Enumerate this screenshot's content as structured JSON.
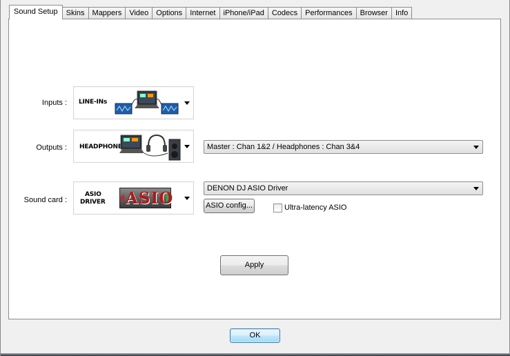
{
  "tabs": [
    {
      "label": "Sound Setup",
      "active": true
    },
    {
      "label": "Skins"
    },
    {
      "label": "Mappers"
    },
    {
      "label": "Video"
    },
    {
      "label": "Options"
    },
    {
      "label": "Internet"
    },
    {
      "label": "iPhone/iPad"
    },
    {
      "label": "Codecs"
    },
    {
      "label": "Performances"
    },
    {
      "label": "Browser"
    },
    {
      "label": "Info"
    }
  ],
  "sound_setup": {
    "inputs": {
      "label": "Inputs :",
      "image_text": "LINE-INs"
    },
    "outputs": {
      "label": "Outputs :",
      "image_text": "HEADPHONES",
      "routing_value": "Master : Chan 1&2 / Headphones : Chan 3&4"
    },
    "sound_card": {
      "label": "Sound card :",
      "image_text_line1": "ASIO",
      "image_text_line2": "DRIVER",
      "logo_text": "ASIO",
      "driver_value": "DENON DJ ASIO Driver",
      "config_button": "ASIO config...",
      "ultra_latency_label": "Ultra-latency ASIO",
      "ultra_latency_checked": false
    },
    "apply_button": "Apply"
  },
  "footer": {
    "ok_button": "OK"
  },
  "colors": {
    "logo_red": "#d42020",
    "logo_green": "#2fae3a",
    "default_button_border": "#3c7fb1"
  }
}
